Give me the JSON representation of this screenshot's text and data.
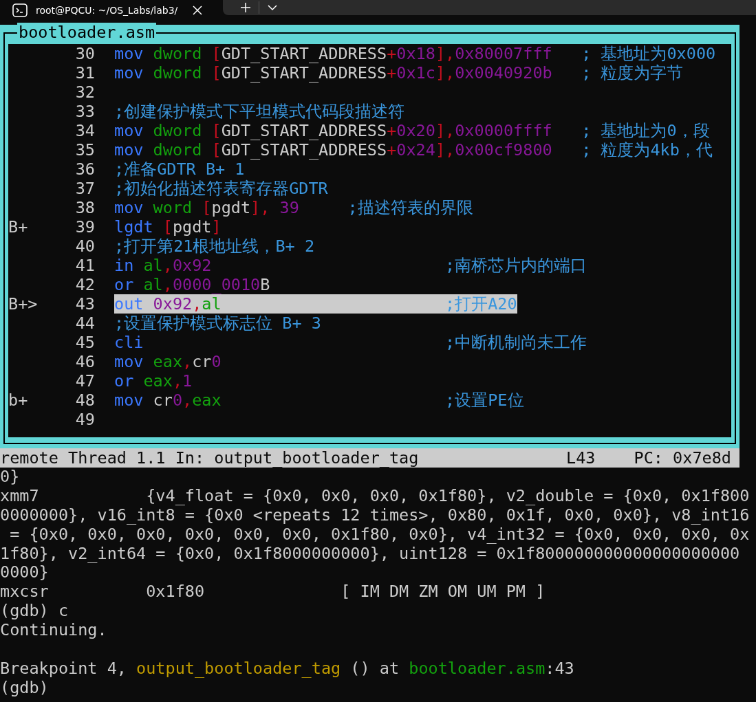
{
  "tab": {
    "title": "root@PQCU: ~/OS_Labs/lab3/"
  },
  "source": {
    "title": "bootloader.asm",
    "lines": [
      {
        "number": "30",
        "selected": false,
        "code": [
          {
            "kind": "kw",
            "t": "mov "
          },
          {
            "kind": "sz",
            "t": "dword "
          },
          {
            "kind": "br",
            "t": "["
          },
          {
            "kind": "id",
            "t": "GDT_START_ADDRESS"
          },
          {
            "kind": "br",
            "t": "+"
          },
          {
            "kind": "num",
            "t": "0x18"
          },
          {
            "kind": "br",
            "t": "],"
          },
          {
            "kind": "num",
            "t": "0x80007fff   "
          }
        ],
        "comment": "; 基地址为0x000"
      },
      {
        "number": "31",
        "selected": false,
        "code": [
          {
            "kind": "kw",
            "t": "mov "
          },
          {
            "kind": "sz",
            "t": "dword "
          },
          {
            "kind": "br",
            "t": "["
          },
          {
            "kind": "id",
            "t": "GDT_START_ADDRESS"
          },
          {
            "kind": "br",
            "t": "+"
          },
          {
            "kind": "num",
            "t": "0x1c"
          },
          {
            "kind": "br",
            "t": "],"
          },
          {
            "kind": "num",
            "t": "0x0040920b   "
          }
        ],
        "comment": "; 粒度为字节"
      },
      {
        "number": "32",
        "selected": false
      },
      {
        "number": "33",
        "selected": false,
        "code": [
          {
            "kind": "cm",
            "t": ";创建保护模式下平坦模式代码段描述符"
          }
        ]
      },
      {
        "number": "34",
        "selected": false,
        "code": [
          {
            "kind": "kw",
            "t": "mov "
          },
          {
            "kind": "sz",
            "t": "dword "
          },
          {
            "kind": "br",
            "t": "["
          },
          {
            "kind": "id",
            "t": "GDT_START_ADDRESS"
          },
          {
            "kind": "br",
            "t": "+"
          },
          {
            "kind": "num",
            "t": "0x20"
          },
          {
            "kind": "br",
            "t": "],"
          },
          {
            "kind": "num",
            "t": "0x0000ffff   "
          }
        ],
        "comment": "; 基地址为0，段"
      },
      {
        "number": "35",
        "selected": false,
        "code": [
          {
            "kind": "kw",
            "t": "mov "
          },
          {
            "kind": "sz",
            "t": "dword "
          },
          {
            "kind": "br",
            "t": "["
          },
          {
            "kind": "id",
            "t": "GDT_START_ADDRESS"
          },
          {
            "kind": "br",
            "t": "+"
          },
          {
            "kind": "num",
            "t": "0x24"
          },
          {
            "kind": "br",
            "t": "],"
          },
          {
            "kind": "num",
            "t": "0x00cf9800   "
          }
        ],
        "comment": "; 粒度为4kb，代"
      },
      {
        "number": "36",
        "selected": false,
        "code": [
          {
            "kind": "cm",
            "t": ";准备GDTR B+ 1"
          }
        ]
      },
      {
        "number": "37",
        "selected": false,
        "code": [
          {
            "kind": "cm",
            "t": ";初始化描述符表寄存器GDTR"
          }
        ]
      },
      {
        "number": "38",
        "selected": false,
        "code": [
          {
            "kind": "kw",
            "t": "mov "
          },
          {
            "kind": "sz",
            "t": "word "
          },
          {
            "kind": "br",
            "t": "["
          },
          {
            "kind": "id",
            "t": "pgdt"
          },
          {
            "kind": "br",
            "t": "], "
          },
          {
            "kind": "num",
            "t": "39     "
          }
        ],
        "comment": ";描述符表的界限"
      },
      {
        "marker": "B+",
        "number": "39",
        "selected": false,
        "code": [
          {
            "kind": "kw",
            "t": "lgdt "
          },
          {
            "kind": "br",
            "t": "["
          },
          {
            "kind": "id",
            "t": "pgdt"
          },
          {
            "kind": "br",
            "t": "]"
          }
        ]
      },
      {
        "number": "40",
        "selected": false,
        "code": [
          {
            "kind": "cm",
            "t": ";打开第21根地址线，B+ 2"
          }
        ]
      },
      {
        "number": "41",
        "selected": false,
        "code": [
          {
            "kind": "kw",
            "t": "in "
          },
          {
            "kind": "sz",
            "t": "al"
          },
          {
            "kind": "br",
            "t": ","
          },
          {
            "kind": "num",
            "t": "0x92                        "
          }
        ],
        "comment": ";南桥芯片内的端口"
      },
      {
        "number": "42",
        "selected": false,
        "code": [
          {
            "kind": "kw",
            "t": "or "
          },
          {
            "kind": "sz",
            "t": "al"
          },
          {
            "kind": "br",
            "t": ","
          },
          {
            "kind": "num",
            "t": "0000_0010"
          },
          {
            "kind": "id",
            "t": "B"
          }
        ]
      },
      {
        "marker": "B+>",
        "number": "43",
        "selected": true,
        "code": [
          {
            "kind": "kw",
            "t": "out "
          },
          {
            "kind": "num",
            "t": "0x92"
          },
          {
            "kind": "br",
            "t": ","
          },
          {
            "kind": "sz",
            "t": "al                       "
          }
        ],
        "comment": ";打开A20"
      },
      {
        "number": "44",
        "selected": false,
        "code": [
          {
            "kind": "cm",
            "t": ";设置保护模式标志位 B+ 3"
          }
        ]
      },
      {
        "number": "45",
        "selected": false,
        "code": [
          {
            "kind": "kw",
            "t": "cli                               "
          }
        ],
        "comment": ";中断机制尚未工作"
      },
      {
        "number": "46",
        "selected": false,
        "code": [
          {
            "kind": "kw",
            "t": "mov "
          },
          {
            "kind": "sz",
            "t": "eax"
          },
          {
            "kind": "br",
            "t": ","
          },
          {
            "kind": "id",
            "t": "cr"
          },
          {
            "kind": "num",
            "t": "0"
          }
        ]
      },
      {
        "number": "47",
        "selected": false,
        "code": [
          {
            "kind": "kw",
            "t": "or "
          },
          {
            "kind": "sz",
            "t": "eax"
          },
          {
            "kind": "br",
            "t": ","
          },
          {
            "kind": "num",
            "t": "1"
          }
        ]
      },
      {
        "marker": "b+",
        "number": "48",
        "selected": false,
        "code": [
          {
            "kind": "kw",
            "t": "mov "
          },
          {
            "kind": "id",
            "t": "cr"
          },
          {
            "kind": "num",
            "t": "0"
          },
          {
            "kind": "br",
            "t": ","
          },
          {
            "kind": "sz",
            "t": "eax                       "
          }
        ],
        "comment": ";设置PE位"
      },
      {
        "number": "49",
        "selected": false
      }
    ]
  },
  "status_bar": {
    "left": "remote Thread 1.1 In: output_bootloader_tag",
    "line": "L43",
    "pc": "PC: 0x7e8d"
  },
  "console": [
    {
      "kind": "text",
      "segments": [
        {
          "kind": "plain",
          "t": "0}"
        }
      ]
    },
    {
      "kind": "text",
      "segments": [
        {
          "kind": "plain",
          "t": "xmm7           {v4_float = {0x0, 0x0, 0x0, 0x1f80}, v2_double = {0x0, 0x1f800"
        }
      ]
    },
    {
      "kind": "text",
      "segments": [
        {
          "kind": "plain",
          "t": "0000000}, v16_int8 = {0x0 <repeats 12 times>, 0x80, 0x1f, 0x0, 0x0}, v8_int16"
        }
      ]
    },
    {
      "kind": "text",
      "segments": [
        {
          "kind": "plain",
          "t": " = {0x0, 0x0, 0x0, 0x0, 0x0, 0x0, 0x1f80, 0x0}, v4_int32 = {0x0, 0x0, 0x0, 0x"
        }
      ]
    },
    {
      "kind": "text",
      "segments": [
        {
          "kind": "plain",
          "t": "1f80}, v2_int64 = {0x0, 0x1f8000000000}, uint128 = 0x1f800000000000000000000"
        }
      ]
    },
    {
      "kind": "text",
      "segments": [
        {
          "kind": "plain",
          "t": "0000}"
        }
      ]
    },
    {
      "kind": "text",
      "segments": [
        {
          "kind": "plain",
          "t": "mxcsr          0x1f80              [ IM DM ZM OM UM PM ]"
        }
      ]
    },
    {
      "kind": "text",
      "segments": [
        {
          "kind": "plain",
          "t": "(gdb) c"
        }
      ]
    },
    {
      "kind": "text",
      "segments": [
        {
          "kind": "plain",
          "t": "Continuing."
        }
      ]
    },
    {
      "kind": "blank"
    },
    {
      "kind": "text",
      "segments": [
        {
          "kind": "plain",
          "t": "Breakpoint 4, "
        },
        {
          "kind": "func",
          "t": "output_bootloader_tag"
        },
        {
          "kind": "plain",
          "t": " () at "
        },
        {
          "kind": "file",
          "t": "bootloader.asm"
        },
        {
          "kind": "plain",
          "t": ":43"
        }
      ]
    },
    {
      "kind": "text",
      "segments": [
        {
          "kind": "plain",
          "t": "(gdb)"
        }
      ]
    }
  ]
}
